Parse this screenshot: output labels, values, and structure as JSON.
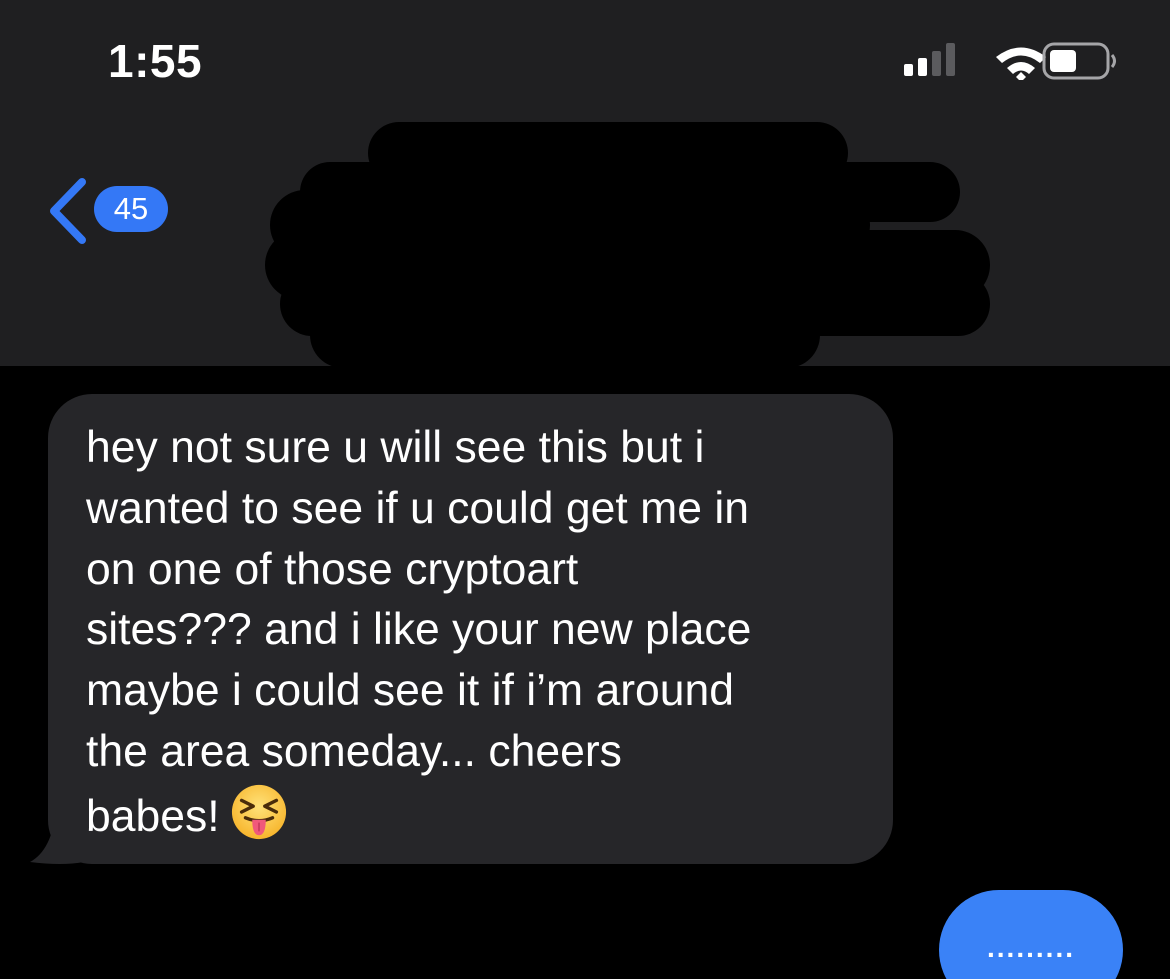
{
  "status_bar": {
    "time": "1:55",
    "signal_icon": "cellular-signal-icon",
    "wifi_icon": "wifi-icon",
    "battery_icon": "battery-icon"
  },
  "nav": {
    "back_icon": "chevron-left-icon",
    "unread_count": "45",
    "contact_name_redacted": true
  },
  "messages": {
    "incoming": {
      "text": "hey not sure u will see this but i\nwanted to see if u could get me in\non one of those cryptoart\nsites??? and i like your new place\nmaybe i could see it if i’m around\nthe area someday... cheers\nbabes!",
      "emoji": "squinting-face-with-tongue"
    },
    "outgoing": {
      "text": "........."
    }
  },
  "colors": {
    "header_bg": "#1f1f21",
    "screen_bg": "#000000",
    "incoming_bubble": "#262629",
    "outgoing_bubble": "#3a82f7",
    "accent": "#3478f6"
  }
}
